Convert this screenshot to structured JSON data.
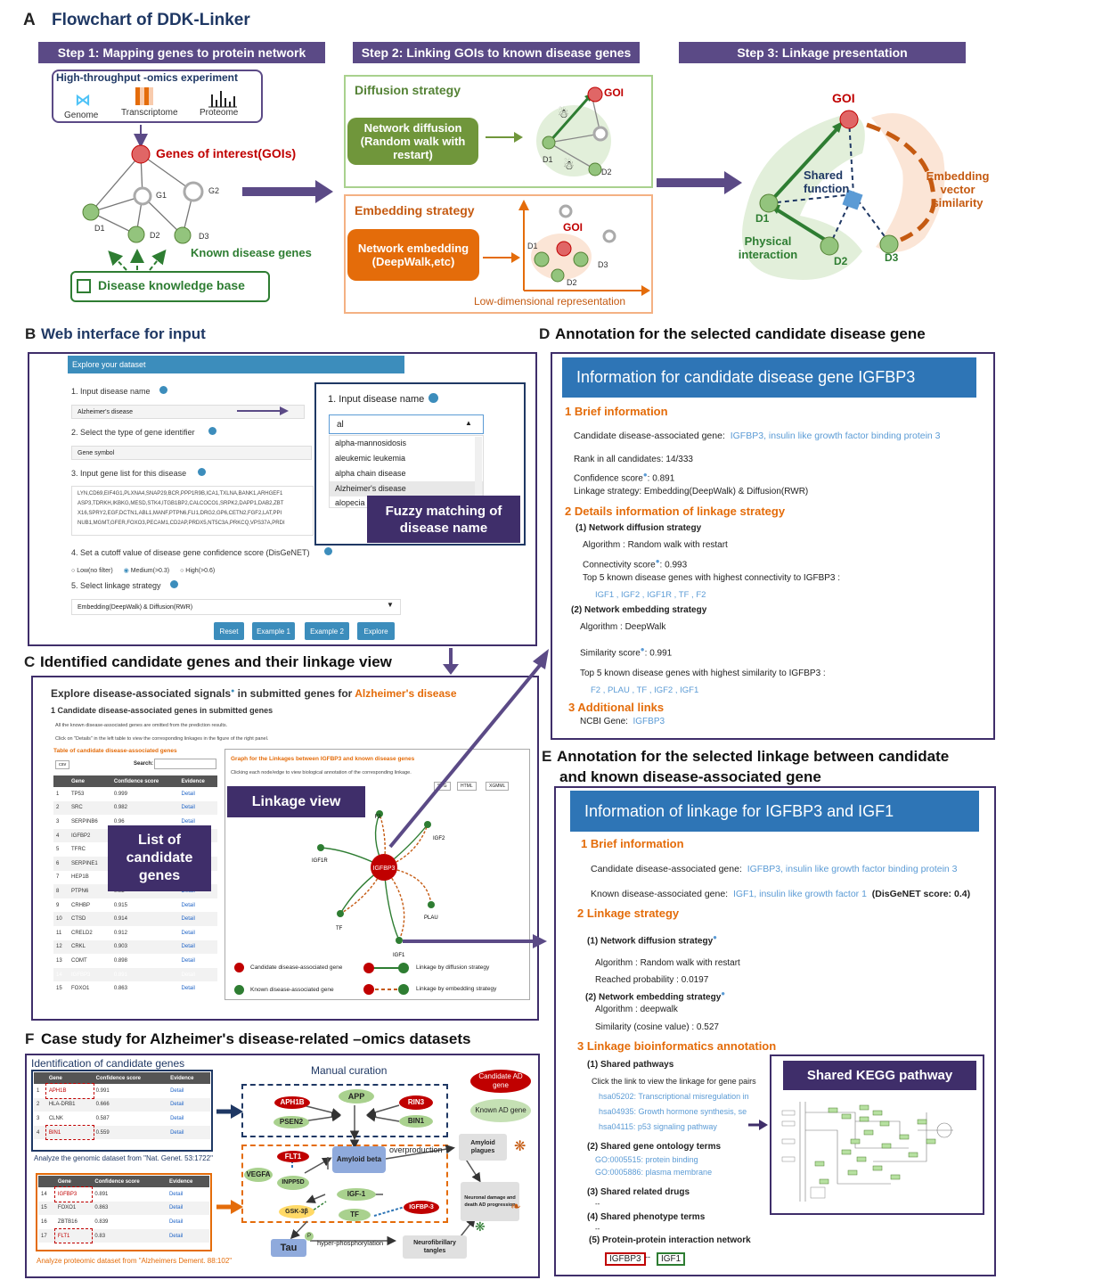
{
  "panelA": {
    "letter": "A",
    "title": "Flowchart of DDK-Linker",
    "step1": "Step 1: Mapping genes to protein network",
    "step2": "Step 2: Linking GOIs to known disease genes",
    "step3": "Step 3: Linkage presentation",
    "omics_title": "High-throughput -omics experiment",
    "genome": "Genome",
    "transcriptome": "Transcriptome",
    "proteome": "Proteome",
    "gois": "Genes of interest(GOIs)",
    "g1": "G1",
    "g2": "G2",
    "d1": "D1",
    "d2": "D2",
    "d3": "D3",
    "known": "Known disease genes",
    "kb": "Disease knowledge base",
    "diffusion_title": "Diffusion strategy",
    "diffusion_box": "Network diffusion (Random walk with restart)",
    "embedding_title": "Embedding strategy",
    "embedding_box": "Network embedding (DeepWalk,etc)",
    "goi": "GOI",
    "lowdim": "Low-dimensional representation",
    "shared_function": "Shared function",
    "embedding_sim": "Embedding vector similarity",
    "physical": "Physical interaction"
  },
  "panelB": {
    "letter": "B",
    "title": "Web interface for input",
    "header": "Explore your dataset",
    "q1": "1. Input disease name",
    "q1_value": "Alzheimer's disease",
    "q2": "2. Select the type of gene identifier",
    "q2_value": "Gene symbol",
    "q3": "3. Input gene list for this disease",
    "genes": "LYN,CD69,EIF4G1,PLXNA4,SNAP29,BCR,PPP1R9B,ICA1,TXLNA,BANK1,ARHGEF1 ASP3,TDRKH,IKBKG,MESD,STK4,ITGB1BP2,CALCOCO1,SRPK2,DAPP1,DAB2,ZBT X16,SPRY2,EGF,DCTN1,ABL1,MANF,PTPN6,FLI1,DRG2,GP6,CETN2,FGF2,LAT,PPI NUB1,MGMT,GFER,FOXO3,PECAM1,CD2AP,PRDX5,NT5C3A,PRKCQ,VPS37A,PRDI",
    "q4": "4. Set a cutoff value of disease gene confidence score (DisGeNET)",
    "opt_low": "Low(no filter)",
    "opt_med": "Medium(>0.3)",
    "opt_high": "High(>0.6)",
    "q5": "5. Select linkage strategy",
    "q5_value": "Embedding(DeepWalk) & Diffusion(RWR)",
    "buttons": [
      "Reset",
      "Example 1",
      "Example 2",
      "Explore"
    ],
    "zoom_q": "1. Input disease name",
    "zoom_input": "al",
    "zoom_options": [
      "alpha-mannosidosis",
      "aleukemic leukemia",
      "alpha chain disease",
      "Alzheimer's disease",
      "alopecia"
    ],
    "fuzzy": "Fuzzy matching of disease name"
  },
  "panelC": {
    "letter": "C",
    "title": "Identified candidate genes and their linkage view",
    "heading": "Explore disease-associated signals",
    "heading_mid": " in submitted genes for ",
    "heading_disease": "Alzheimer's disease",
    "sub": "1 Candidate disease-associated genes in submitted genes",
    "note1": "All the known disease-associated genes are omitted from the prediction results.",
    "note2": "Click on \"Details\" in the left table to view the corresponding linkages in the figure of the right panel.",
    "table_title": "Table of candidate disease-associated genes",
    "csv": "csv",
    "search": "Search:",
    "cols": [
      "",
      "Gene",
      "Confidence score",
      "Evidence"
    ],
    "rows": [
      [
        "1",
        "TP53",
        "0.999",
        "Detail"
      ],
      [
        "2",
        "SRC",
        "0.982",
        "Detail"
      ],
      [
        "3",
        "SERPINB6",
        "0.96",
        "Detail"
      ],
      [
        "4",
        "IGFBP2",
        "0.95",
        "Detail"
      ],
      [
        "5",
        "TFRC",
        "0.93",
        "Detail"
      ],
      [
        "6",
        "SERPINE1",
        "0.93",
        "Detail"
      ],
      [
        "7",
        "HEP1B",
        "0.92",
        "Detail"
      ],
      [
        "8",
        "PTPN6",
        "0.92",
        "Detail"
      ],
      [
        "9",
        "CRHBP",
        "0.915",
        "Detail"
      ],
      [
        "10",
        "CTSD",
        "0.914",
        "Detail"
      ],
      [
        "11",
        "CRELD2",
        "0.912",
        "Detail"
      ],
      [
        "12",
        "CRKL",
        "0.903",
        "Detail"
      ],
      [
        "13",
        "COMT",
        "0.898",
        "Detail"
      ],
      [
        "14",
        "IGFBP3",
        "0.891",
        "Detail"
      ],
      [
        "15",
        "FOXO1",
        "0.863",
        "Detail"
      ]
    ],
    "list_label": "List of candidate genes",
    "graph_title": "Graph for the Linkages between IGFBP3 and known disease genes",
    "graph_note": "Clicking each node/edge to view biological annotation of the corresponding linkage.",
    "linkage_label": "Linkage view",
    "graph_buttons": [
      "SVG",
      "HTML",
      "XGMML"
    ],
    "center": "IGFBP3",
    "nodes": [
      "F2",
      "IGF2",
      "IGF1R",
      "PLAU",
      "TF",
      "IGF1"
    ],
    "legend": [
      "Candidate disease-associated gene",
      "Known disease-associated gene",
      "Linkage by diffusion  strategy",
      "Linkage by embedding  strategy"
    ]
  },
  "panelD": {
    "letter": "D",
    "title": "Annotation for the selected candidate disease gene",
    "header": "Information for candidate disease gene IGFBP3",
    "s1": "1 Brief information",
    "cand_label": "Candidate disease-associated gene:",
    "cand_value": "IGFBP3, insulin like growth factor binding protein 3",
    "rank": "Rank in all candidates: 14/333",
    "conf": "Confidence score",
    "conf_val": ": 0.891",
    "strategy": "Linkage strategy: Embedding(DeepWalk) & Diffusion(RWR)",
    "s2": "2 Details information of linkage strategy",
    "nd": "(1) Network diffusion strategy",
    "nd_alg": "Algorithm : Random walk with restart",
    "conn": "Connectivity score",
    "conn_val": ": 0.993",
    "top5_conn": "Top 5 known disease genes with highest connectivity to IGFBP3 :",
    "top5_conn_genes": "IGF1 , IGF2 , IGF1R , TF , F2",
    "ne": "(2) Network embedding strategy",
    "ne_alg": "Algorithm : DeepWalk",
    "sim": "Similarity score",
    "sim_val": ": 0.991",
    "top5_sim": "Top 5 known disease genes with highest similarity to IGFBP3 :",
    "top5_sim_genes": "F2 , PLAU , TF , IGF2 , IGF1",
    "s3": "3 Additional links",
    "ncbi": "NCBI Gene:",
    "ncbi_val": "IGFBP3"
  },
  "panelE": {
    "letter": "E",
    "title1": "Annotation for the selected linkage between  candidate",
    "title2": "and known disease-associated gene",
    "header": "Information of linkage for IGFBP3 and IGF1",
    "s1": "1 Brief information",
    "cand_label": "Candidate disease-associated gene:",
    "cand_value": "IGFBP3, insulin like growth factor binding protein 3",
    "known_label": "Known disease-associated gene:",
    "known_value": "IGF1, insulin like growth factor 1",
    "disgenet": "(DisGeNET score: 0.4)",
    "s2": "2 Linkage strategy",
    "nd": "(1) Network diffusion strategy",
    "nd_alg": "Algorithm : Random walk with restart",
    "reached": "Reached probability : 0.0197",
    "ne": "(2) Network embedding strategy",
    "ne_alg": "Algorithm : deepwalk",
    "sim": "Similarity (cosine value) : 0.527",
    "s3": "3 Linkage bioinformatics annotation",
    "sp": "(1) Shared pathways",
    "sp_note": "Click the link to view the linkage for gene pairs",
    "pathways": [
      "hsa05202: Transcriptional misregulation in",
      "hsa04935: Growth hormone synthesis, se",
      "hsa04115: p53 signaling pathway"
    ],
    "go": "(2) Shared gene ontology terms",
    "go_terms": [
      "GO:0005515: protein binding",
      "GO:0005886: plasma membrane"
    ],
    "drugs": "(3) Shared related drugs",
    "drugs_val": "--",
    "pheno": "(4) Shared phenotype terms",
    "pheno_val": "--",
    "ppi": "(5) Protein-protein interaction network",
    "ppi_a": "IGFBP3",
    "ppi_dash": "--",
    "ppi_b": "IGF1",
    "kegg": "Shared KEGG pathway"
  },
  "panelF": {
    "letter": "F",
    "title": "Case study for Alzheimer's disease-related –omics datasets",
    "ident": "Identification of candidate genes",
    "cols": [
      "",
      "Gene",
      "Confidence score",
      "Evidence"
    ],
    "t1": [
      [
        "1",
        "APH1B",
        "0.991",
        "Detail"
      ],
      [
        "2",
        "HLA-DRB1",
        "0.666",
        "Detail"
      ],
      [
        "3",
        "CLNK",
        "0.587",
        "Detail"
      ],
      [
        "4",
        "BIN1",
        "0.559",
        "Detail"
      ]
    ],
    "t1_caption": "Analyze  the genomic dataset  from \"Nat. Genet. 53:1722\"",
    "t2": [
      [
        "14",
        "IGFBP3",
        "0.891",
        "Detail"
      ],
      [
        "15",
        "FOXO1",
        "0.863",
        "Detail"
      ],
      [
        "16",
        "ZBTB16",
        "0.839",
        "Detail"
      ],
      [
        "17",
        "FLT1",
        "0.83",
        "Detail"
      ]
    ],
    "t2_caption": "Analyze  proteomic  dataset  from \"Alzheimers  Dement. 88:102\"",
    "manual": "Manual curation",
    "cand_ad": "Candidate AD gene",
    "known_ad": "Known AD gene",
    "nodes": {
      "aph1b": "APH1B",
      "app": "APP",
      "rin3": "RIN3",
      "psen2": "PSEN2",
      "bin1": "BIN1",
      "flt1": "FLT1",
      "vegfa": "VEGFA",
      "inpp5d": "INPP5D",
      "amyloid_beta": "Amyloid beta",
      "overproduction": "overproduction",
      "amyloid_plaques": "Amyloid plagues",
      "igf1": "IGF-1",
      "igfbp3": "IGFBP-3",
      "tf": "TF",
      "gsk": "GSK-3β",
      "neuronal": "Neuronal damage and death  AD progression",
      "p": "P",
      "tau": "Tau",
      "hyper": "hyper-phosphorylation",
      "tangles": "Neurofibrillary tangles"
    }
  }
}
